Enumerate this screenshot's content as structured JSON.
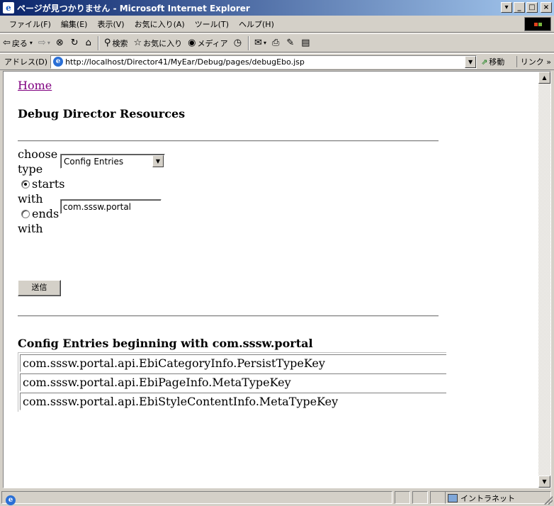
{
  "window": {
    "title": "ページが見つかりません - Microsoft Internet Explorer",
    "minimize_glyph": "_",
    "maximize_glyph": "□",
    "close_glyph": "×",
    "extra_glyph": "▾"
  },
  "menu": [
    "ファイル(F)",
    "編集(E)",
    "表示(V)",
    "お気に入り(A)",
    "ツール(T)",
    "ヘルプ(H)"
  ],
  "toolbar": {
    "back": "戻る",
    "search": "検索",
    "favorites": "お気に入り",
    "media": "メディア"
  },
  "address": {
    "label": "アドレス(D)",
    "url": "http://localhost/Director41/MyEar/Debug/pages/debugEbo.jsp",
    "go": "移動",
    "links": "リンク »"
  },
  "page": {
    "home_link": "Home",
    "heading": "Debug Director Resources",
    "choose_type_line1": "choose",
    "choose_type_line2": "type",
    "type_select_value": "Config Entries",
    "starts_label": "starts",
    "with1": "with",
    "ends_label": "ends",
    "with2": "with",
    "search_value": "com.sssw.portal",
    "submit_label": "送信",
    "results_title": "Config Entries beginning with com.sssw.portal",
    "results": [
      "com.sssw.portal.api.EbiCategoryInfo.PersistTypeKey",
      "com.sssw.portal.api.EbiPageInfo.MetaTypeKey",
      "com.sssw.portal.api.EbiStyleContentInfo.MetaTypeKey"
    ],
    "match_mode": "starts"
  },
  "status": {
    "zone": "イントラネット"
  }
}
